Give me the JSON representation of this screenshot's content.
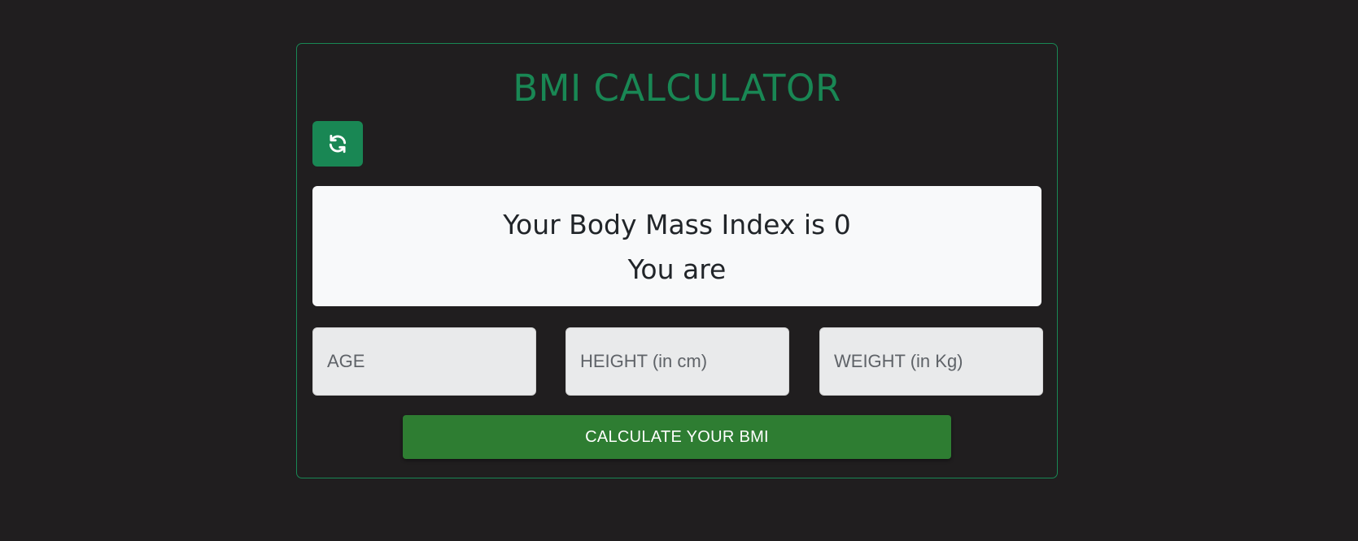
{
  "app": {
    "title": "BMI CALCULATOR"
  },
  "reset_button": {
    "icon": "refresh-icon"
  },
  "result": {
    "bmi_text": "Your Body Mass Index is 0",
    "status_text": "You are"
  },
  "inputs": {
    "age": {
      "placeholder": "AGE",
      "value": ""
    },
    "height": {
      "placeholder": "HEIGHT (in cm)",
      "value": ""
    },
    "weight": {
      "placeholder": "WEIGHT (in Kg)",
      "value": ""
    }
  },
  "calculate_button": {
    "label": "CALCULATE YOUR BMI"
  },
  "colors": {
    "background": "#201e1f",
    "accent": "#198754",
    "button": "#2e7d32",
    "result_bg": "#f8f9fa"
  }
}
